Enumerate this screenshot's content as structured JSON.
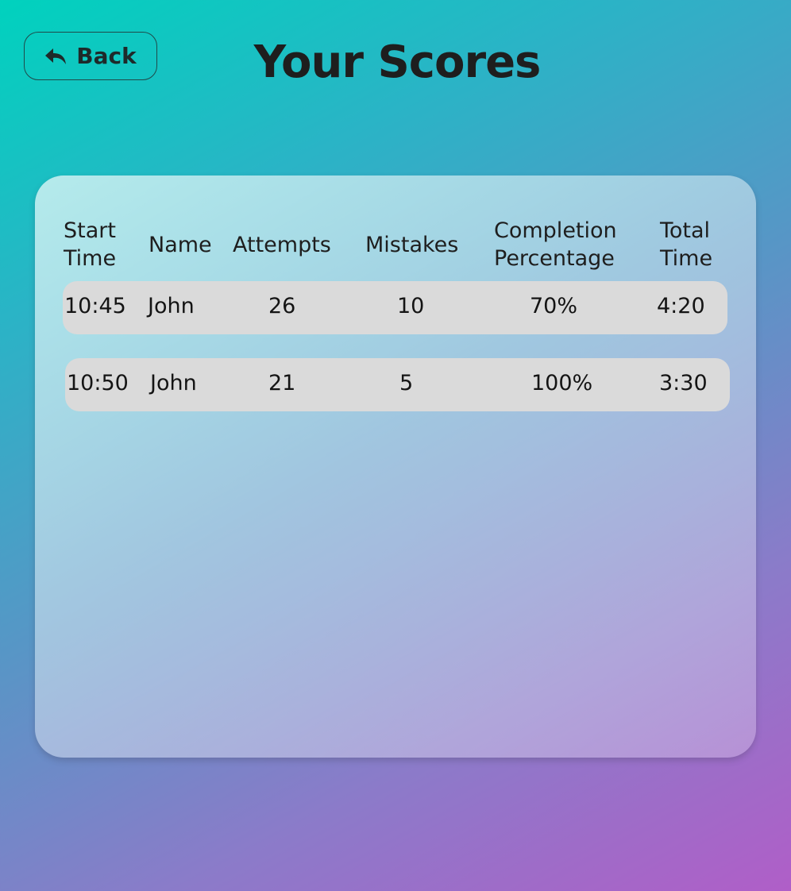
{
  "back_button": {
    "label": "Back",
    "icon": "reply-arrow-icon"
  },
  "page_title": "Your Scores",
  "table": {
    "headers": {
      "start_time": [
        "Start",
        "Time"
      ],
      "name": [
        "Name"
      ],
      "attempts": [
        "Attempts"
      ],
      "mistakes": [
        "Mistakes"
      ],
      "completion": [
        "Completion",
        "Percentage"
      ],
      "total_time": [
        "Total",
        "Time"
      ]
    },
    "rows": [
      {
        "start_time": "10:45",
        "name": "John",
        "attempts": "26",
        "mistakes": "10",
        "completion": "70%",
        "total_time": "4:20"
      },
      {
        "start_time": "10:50",
        "name": "John",
        "attempts": "21",
        "mistakes": "5",
        "completion": "100%",
        "total_time": "3:30"
      }
    ]
  },
  "colors": {
    "gradient_start": "#00d2be",
    "gradient_end": "#b05ec8",
    "row_background": "#dadada",
    "text": "#1e1e1e"
  }
}
